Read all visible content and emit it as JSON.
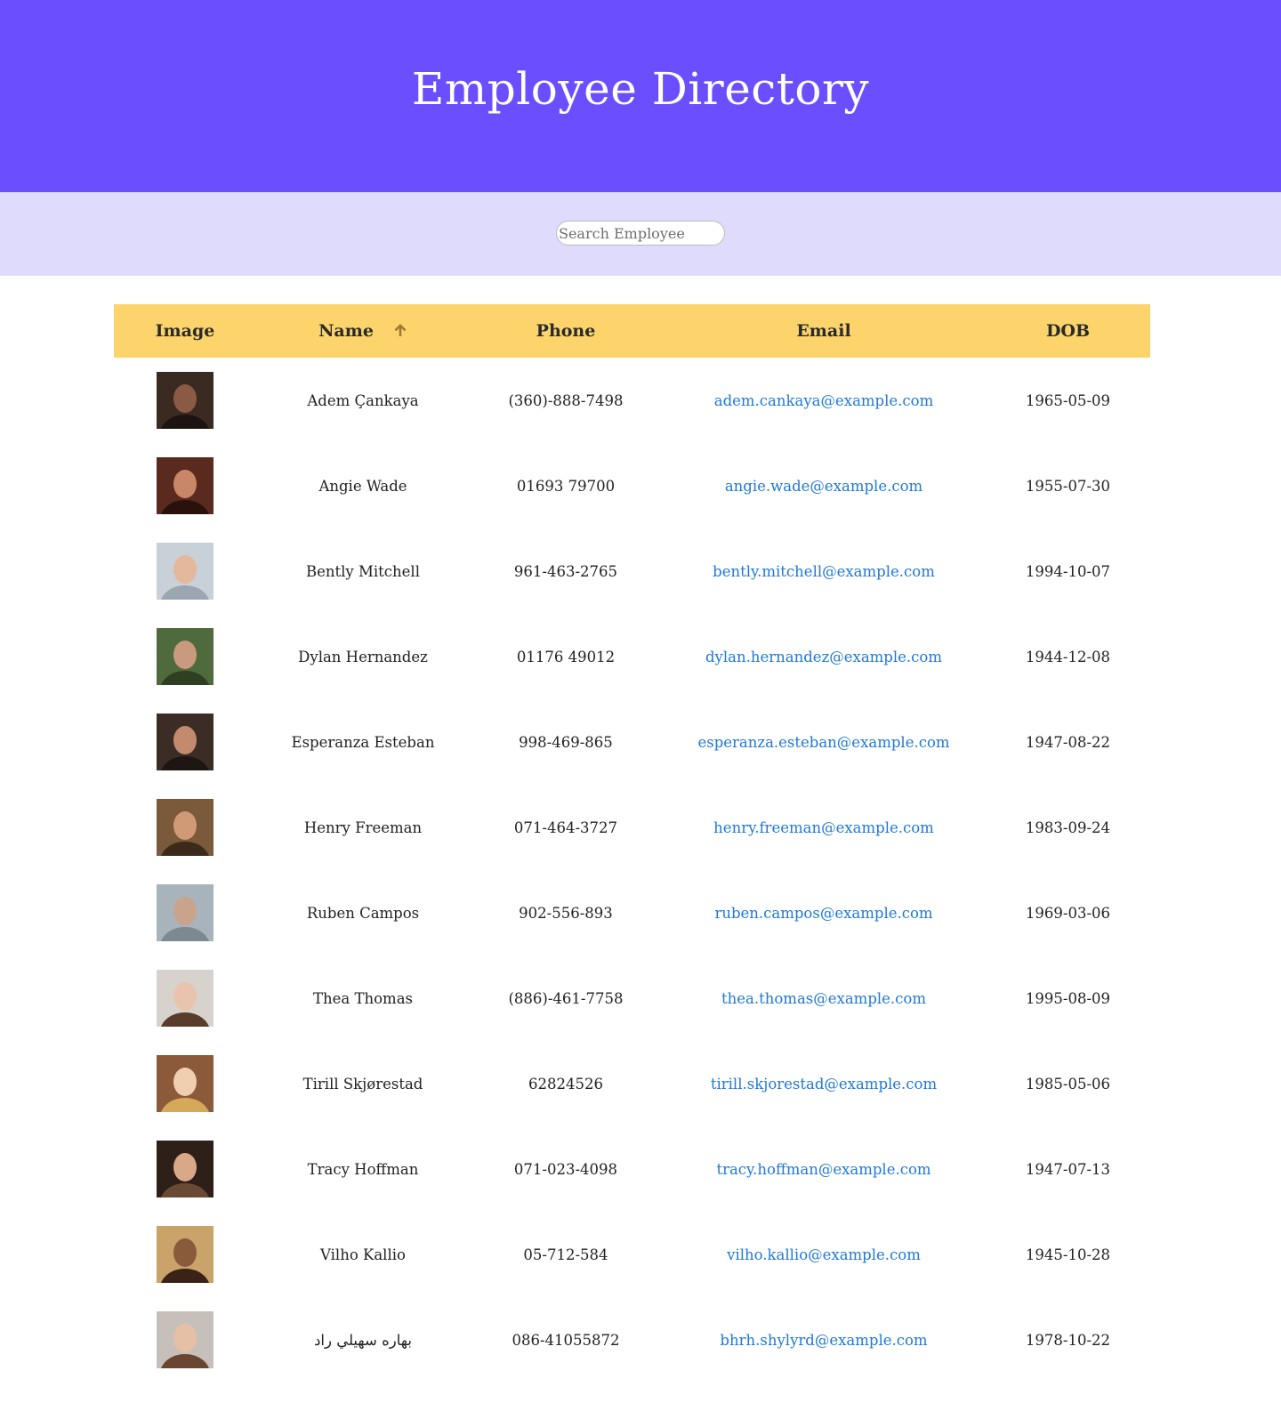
{
  "header": {
    "title": "Employee Directory"
  },
  "search": {
    "placeholder": "Search Employee",
    "value": ""
  },
  "table": {
    "columns": {
      "image": "Image",
      "name": "Name",
      "phone": "Phone",
      "email": "Email",
      "dob": "DOB"
    },
    "sort": {
      "column": "name",
      "direction": "ascending",
      "icon": "arrow-up-icon"
    },
    "rows": [
      {
        "name": "Adem Çankaya",
        "phone": "(360)-888-7498",
        "email": "adem.cankaya@example.com",
        "dob": "1965-05-09"
      },
      {
        "name": "Angie Wade",
        "phone": "01693 79700",
        "email": "angie.wade@example.com",
        "dob": "1955-07-30"
      },
      {
        "name": "Bently Mitchell",
        "phone": "961-463-2765",
        "email": "bently.mitchell@example.com",
        "dob": "1994-10-07"
      },
      {
        "name": "Dylan Hernandez",
        "phone": "01176 49012",
        "email": "dylan.hernandez@example.com",
        "dob": "1944-12-08"
      },
      {
        "name": "Esperanza Esteban",
        "phone": "998-469-865",
        "email": "esperanza.esteban@example.com",
        "dob": "1947-08-22"
      },
      {
        "name": "Henry Freeman",
        "phone": "071-464-3727",
        "email": "henry.freeman@example.com",
        "dob": "1983-09-24"
      },
      {
        "name": "Ruben Campos",
        "phone": "902-556-893",
        "email": "ruben.campos@example.com",
        "dob": "1969-03-06"
      },
      {
        "name": "Thea Thomas",
        "phone": "(886)-461-7758",
        "email": "thea.thomas@example.com",
        "dob": "1995-08-09"
      },
      {
        "name": "Tirill Skjørestad",
        "phone": "62824526",
        "email": "tirill.skjorestad@example.com",
        "dob": "1985-05-06"
      },
      {
        "name": "Tracy Hoffman",
        "phone": "071-023-4098",
        "email": "tracy.hoffman@example.com",
        "dob": "1947-07-13"
      },
      {
        "name": "Vilho Kallio",
        "phone": "05-712-584",
        "email": "vilho.kallio@example.com",
        "dob": "1945-10-28"
      },
      {
        "name": "بهاره سهيلي راد",
        "phone": "086-41055872",
        "email": "bhrh.shylyrd@example.com",
        "dob": "1978-10-22"
      }
    ]
  },
  "colors": {
    "header_bg": "#6b4ffe",
    "search_band_bg": "#dedbfd",
    "table_header_bg": "#fcd46b",
    "link": "#1f78d8"
  }
}
